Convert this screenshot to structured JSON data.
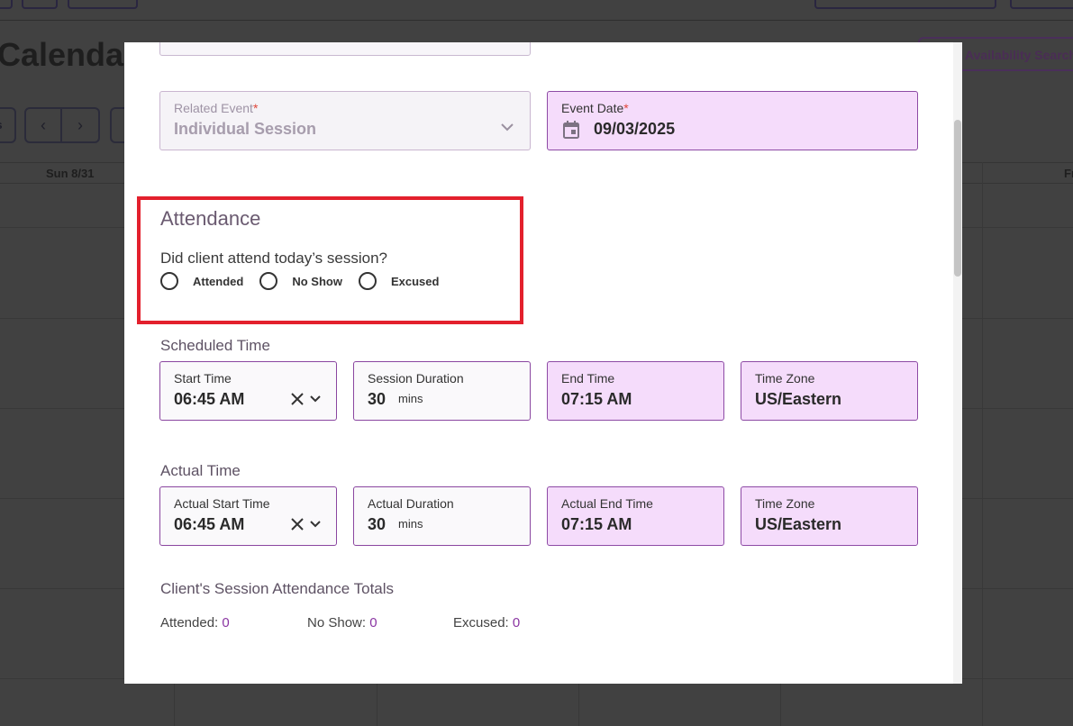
{
  "background": {
    "page_title": "Calendar",
    "availability_button": "Availability Search",
    "nav_prev": "‹",
    "nav_next": "›",
    "partial_left_button": "s",
    "days": [
      "Sun 8/31",
      "Fr"
    ]
  },
  "modal": {
    "related_event": {
      "label": "Related Event",
      "required_mark": "*",
      "value": "Individual Session"
    },
    "event_date": {
      "label": "Event Date",
      "required_mark": "*",
      "value": "09/03/2025"
    },
    "attendance": {
      "title": "Attendance",
      "question": "Did client attend today’s session?",
      "options": [
        "Attended",
        "No Show",
        "Excused"
      ]
    },
    "scheduled_time": {
      "heading": "Scheduled Time",
      "start_time": {
        "label": "Start Time",
        "value": "06:45 AM"
      },
      "duration": {
        "label": "Session Duration",
        "value": "30",
        "unit": "mins"
      },
      "end_time": {
        "label": "End Time",
        "value": "07:15 AM"
      },
      "time_zone": {
        "label": "Time Zone",
        "value": "US/Eastern"
      }
    },
    "actual_time": {
      "heading": "Actual Time",
      "start_time": {
        "label": "Actual Start Time",
        "value": "06:45 AM"
      },
      "duration": {
        "label": "Actual Duration",
        "value": "30",
        "unit": "mins"
      },
      "end_time": {
        "label": "Actual End Time",
        "value": "07:15 AM"
      },
      "time_zone": {
        "label": "Time Zone",
        "value": "US/Eastern"
      }
    },
    "totals": {
      "heading": "Client's Session Attendance Totals",
      "attended_label": "Attended:",
      "attended_count": "0",
      "noshow_label": "No Show:",
      "noshow_count": "0",
      "excused_label": "Excused:",
      "excused_count": "0"
    }
  },
  "colors": {
    "accent_purple": "#8a35a2",
    "field_purple_bg": "#f5dcfb",
    "highlight_red": "#e3202d",
    "overlay": "#414141"
  }
}
